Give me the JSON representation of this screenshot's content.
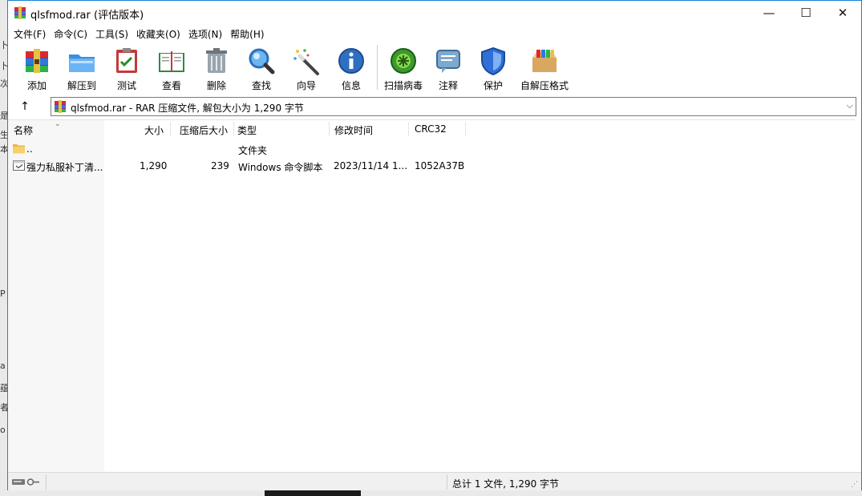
{
  "window": {
    "title": "qlsfmod.rar (评估版本)",
    "controls": {
      "minimize": "—",
      "maximize": "☐",
      "close": "✕"
    }
  },
  "menu": [
    "文件(F)",
    "命令(C)",
    "工具(S)",
    "收藏夹(O)",
    "选项(N)",
    "帮助(H)"
  ],
  "toolbar": [
    {
      "label": "添加",
      "icon": "add-archive-icon"
    },
    {
      "label": "解压到",
      "icon": "extract-folder-icon"
    },
    {
      "label": "测试",
      "icon": "test-clipboard-icon"
    },
    {
      "label": "查看",
      "icon": "view-book-icon"
    },
    {
      "label": "删除",
      "icon": "trash-icon"
    },
    {
      "label": "查找",
      "icon": "find-magnifier-icon"
    },
    {
      "label": "向导",
      "icon": "wizard-wand-icon"
    },
    {
      "label": "信息",
      "icon": "info-icon"
    },
    {
      "label": "扫描病毒",
      "icon": "virus-scan-icon"
    },
    {
      "label": "注释",
      "icon": "comment-icon"
    },
    {
      "label": "保护",
      "icon": "shield-icon"
    },
    {
      "label": "自解压格式",
      "icon": "sfx-box-icon"
    }
  ],
  "address": {
    "up": "↑",
    "text": "qlsfmod.rar - RAR 压缩文件, 解包大小为 1,290 字节",
    "dropdown": "⌵"
  },
  "columns": {
    "name": "名称",
    "size": "大小",
    "packed": "压缩后大小",
    "type": "类型",
    "modified": "修改时间",
    "crc": "CRC32"
  },
  "rows": [
    {
      "name": "..",
      "size": "",
      "packed": "",
      "type": "文件夹",
      "modified": "",
      "crc": "",
      "icon": "folder-icon"
    },
    {
      "name": "强力私服补丁清...",
      "size": "1,290",
      "packed": "239",
      "type": "Windows 命令脚本",
      "modified": "2023/11/14 1...",
      "crc": "1052A37B",
      "icon": "script-file-icon"
    }
  ],
  "status": {
    "text": "总计 1 文件, 1,290 字节"
  },
  "colors": {
    "accent": "#1883d7",
    "tree_bg": "#f7f7f7",
    "status_bg": "#f0f0f0"
  }
}
